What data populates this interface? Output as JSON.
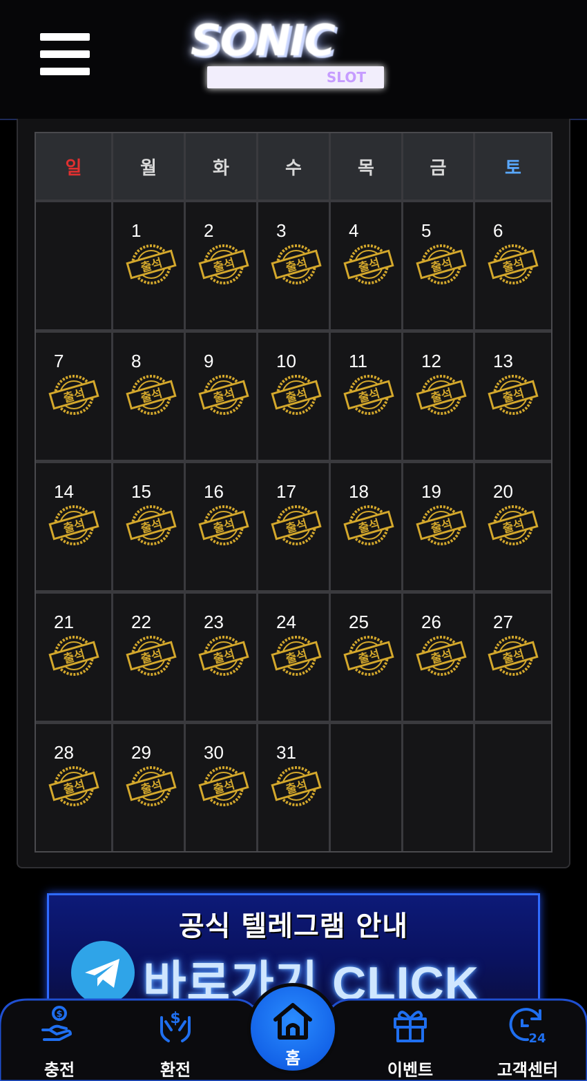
{
  "header": {
    "menu_icon": "hamburger-menu-icon",
    "logo_text": "SONIC",
    "logo_subtext": "SLOT"
  },
  "calendar": {
    "weekdays": [
      "일",
      "월",
      "화",
      "수",
      "목",
      "금",
      "토"
    ],
    "stamp_text": "출석",
    "stamp_icon": "attendance-stamp-icon",
    "weeks": [
      [
        "",
        "1",
        "2",
        "3",
        "4",
        "5",
        "6"
      ],
      [
        "7",
        "8",
        "9",
        "10",
        "11",
        "12",
        "13"
      ],
      [
        "14",
        "15",
        "16",
        "17",
        "18",
        "19",
        "20"
      ],
      [
        "21",
        "22",
        "23",
        "24",
        "25",
        "26",
        "27"
      ],
      [
        "28",
        "29",
        "30",
        "31",
        "",
        "",
        ""
      ]
    ],
    "colors": {
      "sunday": "#e13030",
      "saturday": "#59a8ff",
      "stamp_gold": "#d4a82c"
    }
  },
  "banner": {
    "title": "공식 텔레그램 안내",
    "cta": "바로가기 CLICK",
    "icon": "telegram-icon"
  },
  "bottom_nav": {
    "items": [
      {
        "label": "충전",
        "icon": "deposit-hand-coin-icon"
      },
      {
        "label": "환전",
        "icon": "withdraw-dollar-hands-icon"
      },
      {
        "label": "홈",
        "icon": "home-icon"
      },
      {
        "label": "이벤트",
        "icon": "gift-icon"
      },
      {
        "label": "고객센터",
        "icon": "support-24h-icon"
      }
    ],
    "accent": "#1f6ff0"
  }
}
